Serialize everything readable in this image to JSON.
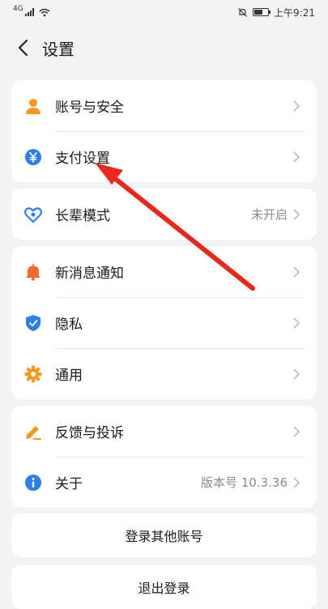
{
  "status_bar": {
    "network": "4G",
    "time": "上午9:21"
  },
  "header": {
    "title": "设置"
  },
  "groups": {
    "g1": [
      {
        "label": "账号与安全",
        "icon": "person-icon"
      },
      {
        "label": "支付设置",
        "icon": "yuan-icon"
      }
    ],
    "g2": [
      {
        "label": "长辈模式",
        "icon": "elder-mode-icon",
        "value": "未开启"
      }
    ],
    "g3": [
      {
        "label": "新消息通知",
        "icon": "bell-icon"
      },
      {
        "label": "隐私",
        "icon": "shield-icon"
      },
      {
        "label": "通用",
        "icon": "gear-icon"
      }
    ],
    "g4": [
      {
        "label": "反馈与投诉",
        "icon": "pencil-icon"
      },
      {
        "label": "关于",
        "icon": "info-icon",
        "value": "版本号 10.3.36"
      }
    ]
  },
  "buttons": {
    "switch_account": "登录其他账号",
    "logout": "退出登录"
  },
  "colors": {
    "accent_orange": "#f39a1e",
    "accent_blue": "#2a7fe8",
    "annotation_red": "#e8281e"
  }
}
